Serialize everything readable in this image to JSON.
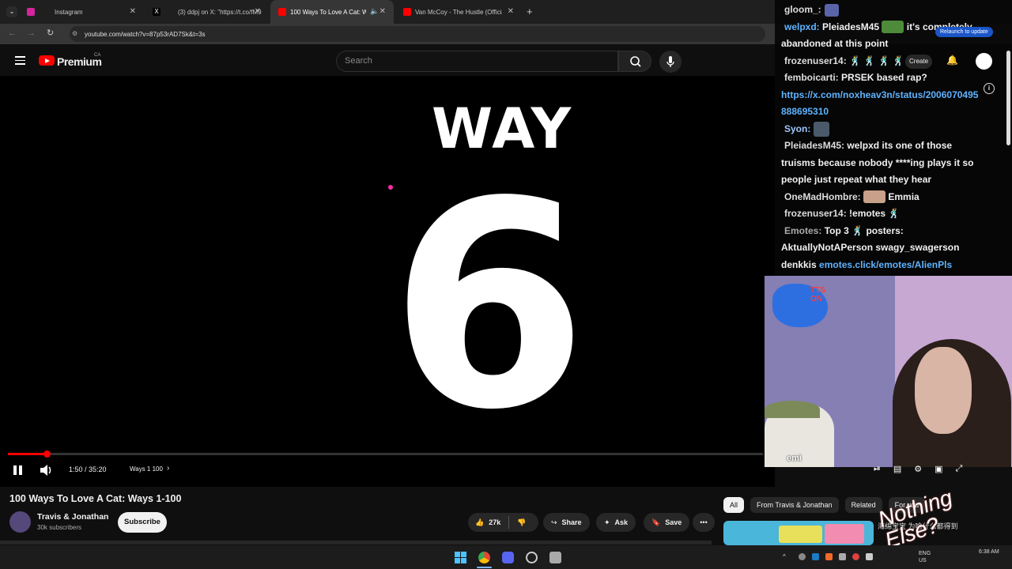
{
  "browser": {
    "tabs": [
      {
        "title": "Instagram",
        "color": "#d6249f"
      },
      {
        "title": "(3) ddpj on X: \"https://t.co/fM9",
        "color": "#000000"
      },
      {
        "title": "100 Ways To Love A Cat: W",
        "color": "#ff0000",
        "active": true
      },
      {
        "title": "Van McCoy - The Hustle (Officia",
        "color": "#ff0000"
      }
    ],
    "url": "youtube.com/watch?v=87p53rAD7Sk&t=3s",
    "relaunch": "Relaunch to update"
  },
  "youtube": {
    "logo": "Premium",
    "region": "CA",
    "search_placeholder": "Search",
    "create": "Create"
  },
  "video": {
    "word": "WAY",
    "number": "6",
    "time": "1:50 / 35:20",
    "chapter": "Ways 1 100",
    "progress": 0.052
  },
  "meta": {
    "title": "100 Ways To Love A Cat: Ways 1-100",
    "channel": "Travis & Jonathan",
    "subs": "30k subscribers",
    "subscribe": "Subscribe",
    "likes": "27k",
    "share": "Share",
    "ask": "Ask",
    "save": "Save"
  },
  "chips": [
    "All",
    "From Travis & Jonathan",
    "Related",
    "For you"
  ],
  "chat": [
    {
      "user": "gloom_:",
      "text": ""
    },
    {
      "user": "welpxd:",
      "text": "PleiadesM45",
      "tail": "it's completely"
    },
    {
      "user": "",
      "text": "abandoned at this point"
    },
    {
      "user": "frozenuser14:",
      "text": ""
    },
    {
      "user": "femboicarti:",
      "text": "PRSEK based rap?"
    },
    {
      "user": "",
      "text": "",
      "link": "https://x.com/noxheav3n/status/2006070495"
    },
    {
      "user": "",
      "text": "",
      "link": "888695310"
    },
    {
      "user": "Syon:",
      "text": ""
    },
    {
      "user": "PleiadesM45:",
      "text": "welpxd its one of those"
    },
    {
      "user": "",
      "text": "truisms because nobody ****ing plays it so"
    },
    {
      "user": "",
      "text": "people just repeat what they hear"
    },
    {
      "user": "OneMadHombre:",
      "text": "Emmia"
    },
    {
      "user": "frozenuser14:",
      "text": "!emotes"
    },
    {
      "user": "Emotes:",
      "text": "Top 3",
      "tail": "posters:"
    },
    {
      "user": "",
      "text": "AktuallyNotAPerson swagy_swagerson"
    },
    {
      "user": "",
      "text": "denkkis",
      "link": "emotes.click/emotes/AlienPls"
    }
  ],
  "overlay": {
    "tts": "TTS",
    "on": "ON",
    "emi": "emi",
    "brand": "Nothing Else?"
  },
  "sidebar_caption": "海绵宝宝 为啥什么都得到",
  "taskbar": {
    "lang": "ENG",
    "region": "US",
    "time": "6:38 AM"
  },
  "colors": {
    "accent": "#ff0000",
    "link": "#3ea6ff"
  }
}
